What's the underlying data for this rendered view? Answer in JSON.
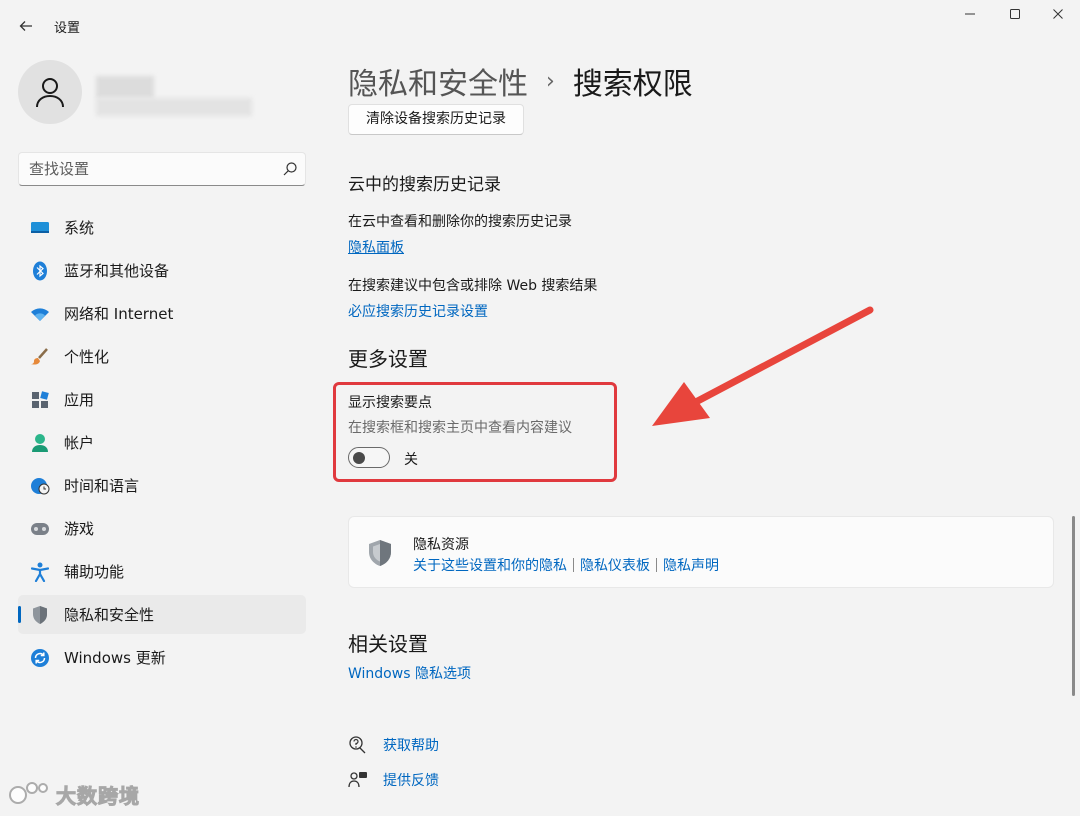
{
  "window": {
    "title": "设置",
    "back_icon": "arrow-left-icon",
    "minimize_glyph": "—",
    "maximize_glyph": "☐",
    "close_glyph": "✕"
  },
  "sidebar": {
    "search": {
      "placeholder": "查找设置",
      "value": ""
    },
    "items": [
      {
        "label": "系统",
        "icon": "monitor-icon",
        "active": false
      },
      {
        "label": "蓝牙和其他设备",
        "icon": "bluetooth-icon",
        "active": false
      },
      {
        "label": "网络和 Internet",
        "icon": "wifi-icon",
        "active": false
      },
      {
        "label": "个性化",
        "icon": "brush-icon",
        "active": false
      },
      {
        "label": "应用",
        "icon": "apps-icon",
        "active": false
      },
      {
        "label": "帐户",
        "icon": "account-icon",
        "active": false
      },
      {
        "label": "时间和语言",
        "icon": "globe-clock-icon",
        "active": false
      },
      {
        "label": "游戏",
        "icon": "gamepad-icon",
        "active": false
      },
      {
        "label": "辅助功能",
        "icon": "accessibility-icon",
        "active": false
      },
      {
        "label": "隐私和安全性",
        "icon": "shield-icon",
        "active": true
      },
      {
        "label": "Windows 更新",
        "icon": "update-icon",
        "active": false
      }
    ]
  },
  "main": {
    "breadcrumb": {
      "parent": "隐私和安全性",
      "separator": "›",
      "current": "搜索权限"
    },
    "clear_history_button": "清除设备搜索历史记录",
    "cloud_history": {
      "title": "云中的搜索历史记录",
      "view_desc": "在云中查看和删除你的搜索历史记录",
      "view_link": "隐私面板",
      "include_desc": "在搜索建议中包含或排除 Web 搜索结果",
      "include_link": "必应搜索历史记录设置"
    },
    "more_settings": {
      "title": "更多设置",
      "toggle_title": "显示搜索要点",
      "toggle_desc": "在搜索框和搜索主页中查看内容建议",
      "toggle_state": "关",
      "toggle_on": false
    },
    "privacy_resources": {
      "title": "隐私资源",
      "links": [
        "关于这些设置和你的隐私",
        "隐私仪表板",
        "隐私声明"
      ]
    },
    "related_settings": {
      "title": "相关设置",
      "link": "Windows 隐私选项"
    },
    "help": {
      "get_help": "获取帮助",
      "feedback": "提供反馈"
    }
  },
  "colors": {
    "accent": "#0067c0",
    "highlight": "#e0393e",
    "arrow": "#e8453c"
  },
  "watermark": {
    "text": "大数跨境"
  }
}
